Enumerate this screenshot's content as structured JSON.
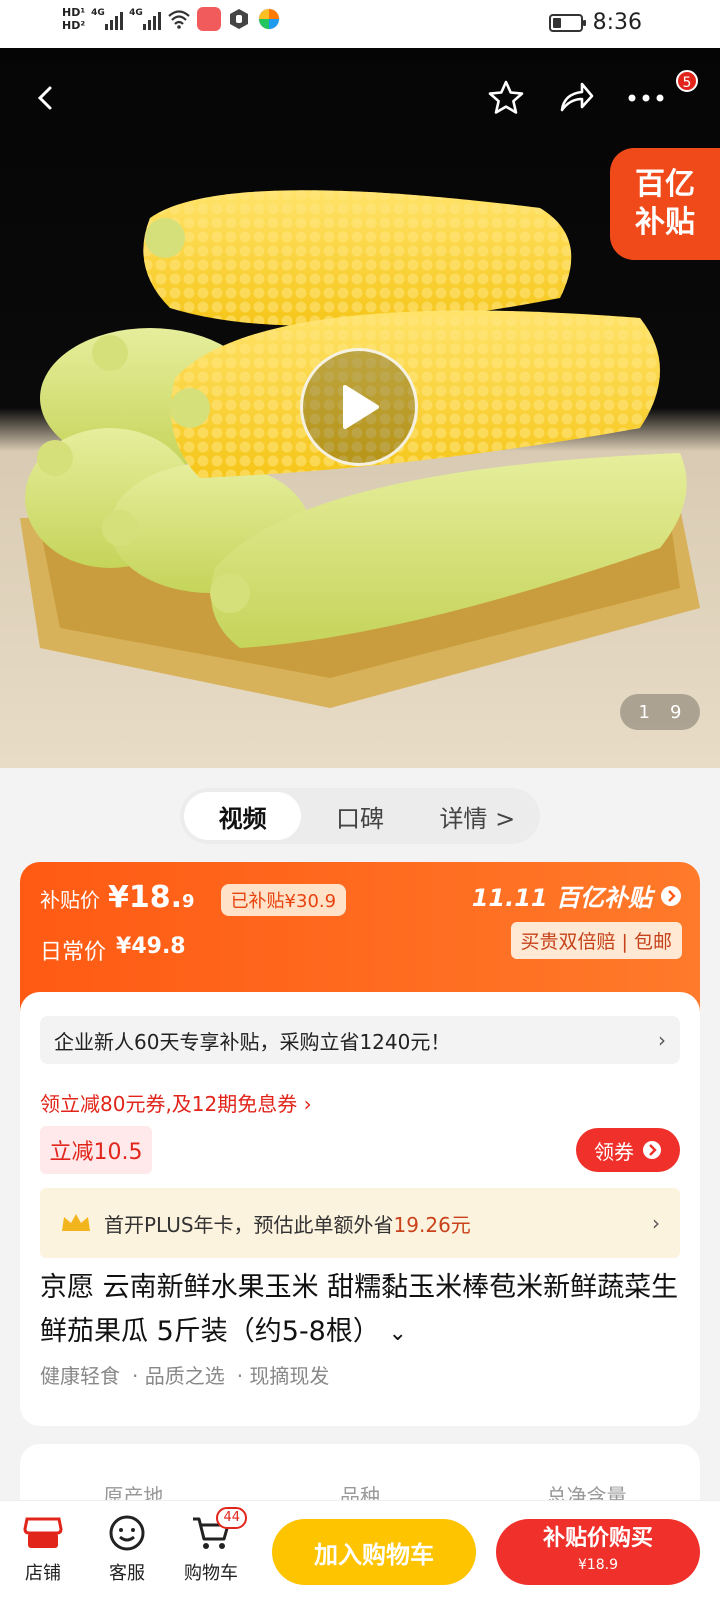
{
  "status_bar": {
    "time": "8:36",
    "network_1": "4G",
    "network_2": "4G"
  },
  "hero": {
    "counter_current": "1",
    "counter_total": "9",
    "subsidy_line1": "百亿",
    "subsidy_line2": "补贴",
    "more_badge": "5"
  },
  "tabs": [
    {
      "label": "视频"
    },
    {
      "label": "口碑"
    },
    {
      "label": "详情 >"
    }
  ],
  "price": {
    "subsidy_label": "补贴价",
    "subsidy_price_main": "¥18.",
    "subsidy_price_decimal": "9",
    "subsidized_amount": "已补贴¥30.9",
    "regular_label": "日常价",
    "regular_price": "¥49.8",
    "promo_brand": "11.11 百亿补贴",
    "guarantee": "买贵双倍赔 | 包邮"
  },
  "offers": {
    "enterprise_notice": "企业新人60天专享补贴，采购立省1240元！",
    "coupon_link": "领立减80元券,及12期免息券 ›",
    "instant_discount": "立减10.5",
    "get_coupon": "领券",
    "plus_prefix": "首开PLUS年卡，预估此单额外省",
    "plus_amount": "19.26元"
  },
  "product": {
    "title": "京愿 云南新鲜水果玉米 甜糯黏玉米棒苞米新鲜蔬菜生鲜茄果瓜 5斤装（约5-8根）",
    "tags": [
      "健康轻食",
      "· 品质之选",
      "· 现摘现发"
    ]
  },
  "specs": [
    {
      "label": "原产地"
    },
    {
      "label": "品种"
    },
    {
      "label": "总净含量"
    }
  ],
  "bottom_bar": {
    "shop": "店铺",
    "service": "客服",
    "cart": "购物车",
    "cart_count": "44",
    "add_to_cart": "加入购物车",
    "buy_now": "补贴价购买",
    "buy_price": "¥18.9"
  },
  "colors": {
    "accent": "#f0302a",
    "orange": "#ff5a14",
    "yellow": "#ffc400"
  }
}
